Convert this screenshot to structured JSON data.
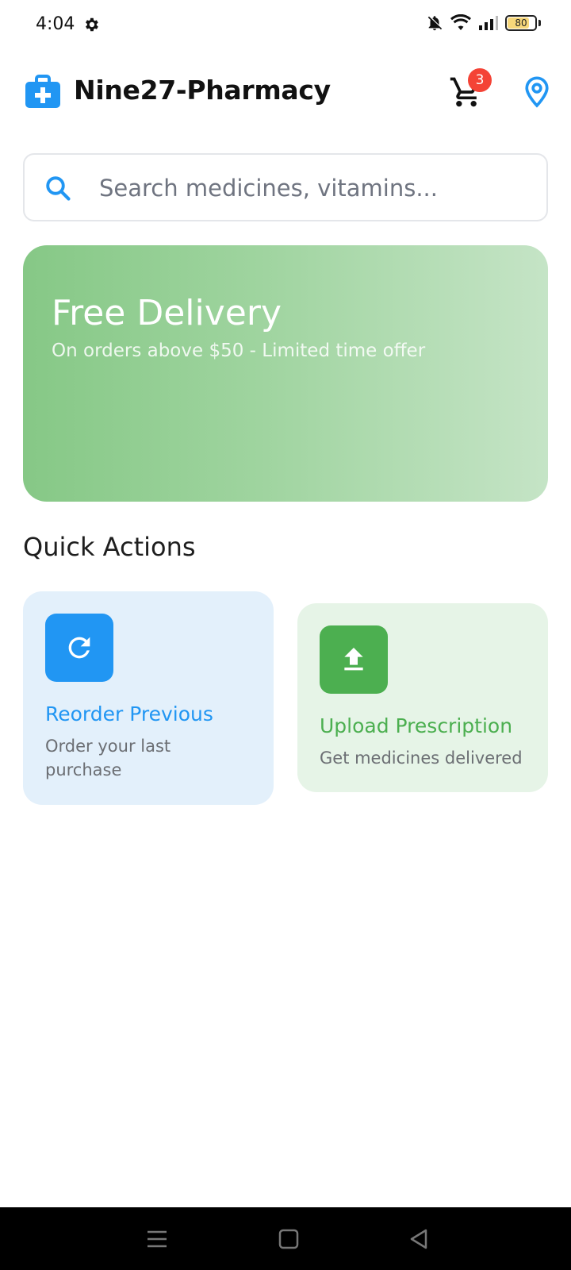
{
  "status_bar": {
    "time": "4:04",
    "battery_level": "80",
    "battery_fraction": 0.8
  },
  "header": {
    "title": "Nine27-Pharmacy",
    "cart_count": "3",
    "brand_color": "#2196f3"
  },
  "search": {
    "placeholder": "Search medicines, vitamins...",
    "value": ""
  },
  "banner": {
    "title": "Free Delivery",
    "subtitle": "On orders above $50 - Limited time offer"
  },
  "quick_actions": {
    "title": "Quick Actions",
    "items": [
      {
        "icon": "refresh-icon",
        "title": "Reorder Previous",
        "description": "Order your last purchase",
        "color": "#2196f3"
      },
      {
        "icon": "upload-icon",
        "title": "Upload Prescription",
        "description": "Get medicines delivered",
        "color": "#4caf50"
      }
    ]
  },
  "icons": {
    "status": [
      "gear-icon",
      "bell-off-icon",
      "wifi-icon",
      "signal-icon",
      "battery-icon"
    ],
    "header": [
      "medical-kit-icon",
      "cart-icon",
      "location-pin-icon"
    ],
    "nav": [
      "menu-icon",
      "home-icon",
      "back-icon"
    ]
  }
}
